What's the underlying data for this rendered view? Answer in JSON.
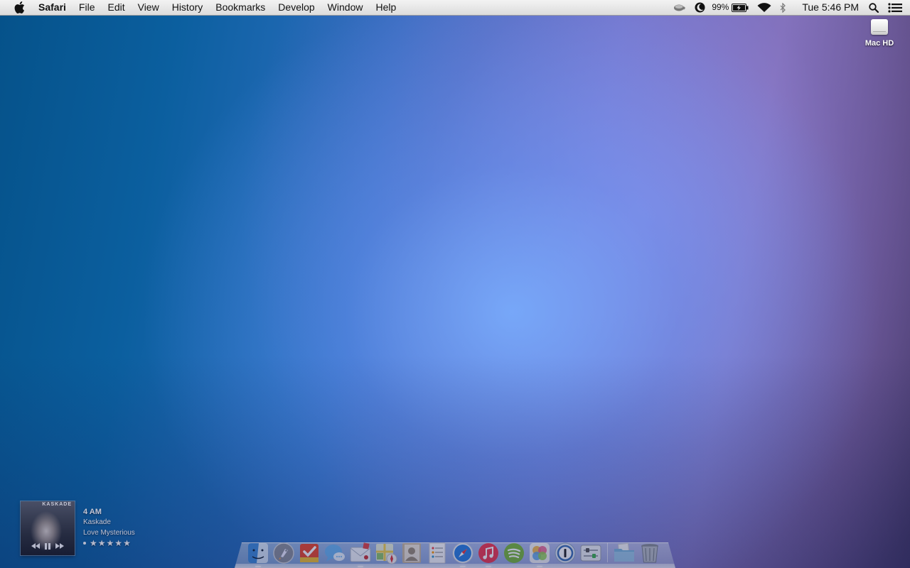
{
  "menubar": {
    "apple_icon": "apple-icon",
    "app_name": "Safari",
    "menus": [
      "File",
      "Edit",
      "View",
      "History",
      "Bookmarks",
      "Develop",
      "Window",
      "Help"
    ],
    "status": {
      "battery_percent": "99%",
      "clock": "Tue 5:46 PM",
      "icons": [
        "coffee-cup-icon",
        "moon-icon",
        "battery-charging-icon",
        "wifi-icon",
        "bluetooth-icon",
        "spotlight-search-icon",
        "notification-center-icon"
      ]
    }
  },
  "desktop": {
    "drive": {
      "label": "Mac HD",
      "icon": "hard-drive-icon"
    }
  },
  "now_playing": {
    "cover_brand": "KASKADE",
    "title": "4 AM",
    "artist": "Kaskade",
    "album": "Love Mysterious",
    "rating": {
      "stars": 5,
      "star_glyph": "★"
    },
    "controls": [
      "previous-icon",
      "pause-icon",
      "next-icon"
    ]
  },
  "dock": {
    "apps": [
      {
        "name": "finder",
        "running": true,
        "color": "#5aa3e8"
      },
      {
        "name": "launchpad",
        "running": false,
        "color": "#8a8f98"
      },
      {
        "name": "wunderlist",
        "running": false,
        "color": "#e8472b"
      },
      {
        "name": "messages",
        "running": false,
        "color": "#6ab4f0"
      },
      {
        "name": "mail",
        "running": true,
        "color": "#e9eef5"
      },
      {
        "name": "maps",
        "running": false,
        "color": "#8fc56a"
      },
      {
        "name": "contacts",
        "running": false,
        "color": "#b4a28a"
      },
      {
        "name": "reminders",
        "running": false,
        "color": "#f4f4f4"
      },
      {
        "name": "safari",
        "running": true,
        "color": "#2a7fe0"
      },
      {
        "name": "itunes",
        "running": true,
        "color": "#f0394f"
      },
      {
        "name": "spotify",
        "running": false,
        "color": "#7ab83a"
      },
      {
        "name": "photos",
        "running": true,
        "color": "#f4b33c"
      },
      {
        "name": "1password",
        "running": false,
        "color": "#3a6fb5"
      },
      {
        "name": "system-preferences",
        "running": false,
        "color": "#8e949c"
      }
    ],
    "stacks": [
      {
        "name": "folder-stack",
        "color": "#7ab4d8"
      },
      {
        "name": "trash",
        "color": "#9aa0a6"
      }
    ]
  }
}
